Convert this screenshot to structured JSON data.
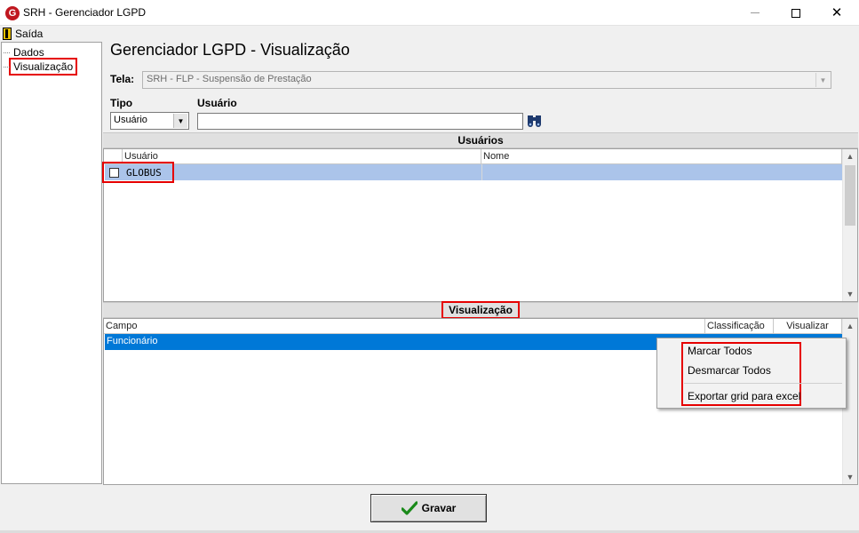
{
  "window": {
    "title": "SRH - Gerenciador LGPD",
    "logo_letter": "G"
  },
  "menubar": {
    "saida": "Saída"
  },
  "tree": {
    "items": [
      {
        "label": "Dados"
      },
      {
        "label": "Visualização"
      }
    ]
  },
  "main": {
    "title": "Gerenciador LGPD - Visualização"
  },
  "tela": {
    "label": "Tela:",
    "value": "SRH - FLP - Suspensão de Prestação"
  },
  "filters": {
    "tipo_label": "Tipo",
    "tipo_value": "Usuário",
    "usuario_label": "Usuário",
    "usuario_value": ""
  },
  "usuarios_section": {
    "title": "Usuários",
    "columns": [
      "Usuário",
      "Nome"
    ],
    "rows": [
      {
        "usuario": "GLOBUS",
        "nome": "",
        "checked": false
      }
    ]
  },
  "visualizacao_section": {
    "title": "Visualização",
    "columns": [
      "Campo",
      "Classificação",
      "Visualizar"
    ],
    "rows": [
      {
        "campo": "Funcionário",
        "classificacao": "",
        "visualizar": ""
      }
    ]
  },
  "context_menu": {
    "items": [
      "Marcar Todos",
      "Desmarcar Todos",
      "Exportar grid para excel"
    ]
  },
  "buttons": {
    "gravar": "Gravar"
  },
  "colors": {
    "highlight_red": "#e60000",
    "user_row_selected": "#abc4ea",
    "vis_row_selected": "#0078d7",
    "logo_red": "#c0171f"
  }
}
